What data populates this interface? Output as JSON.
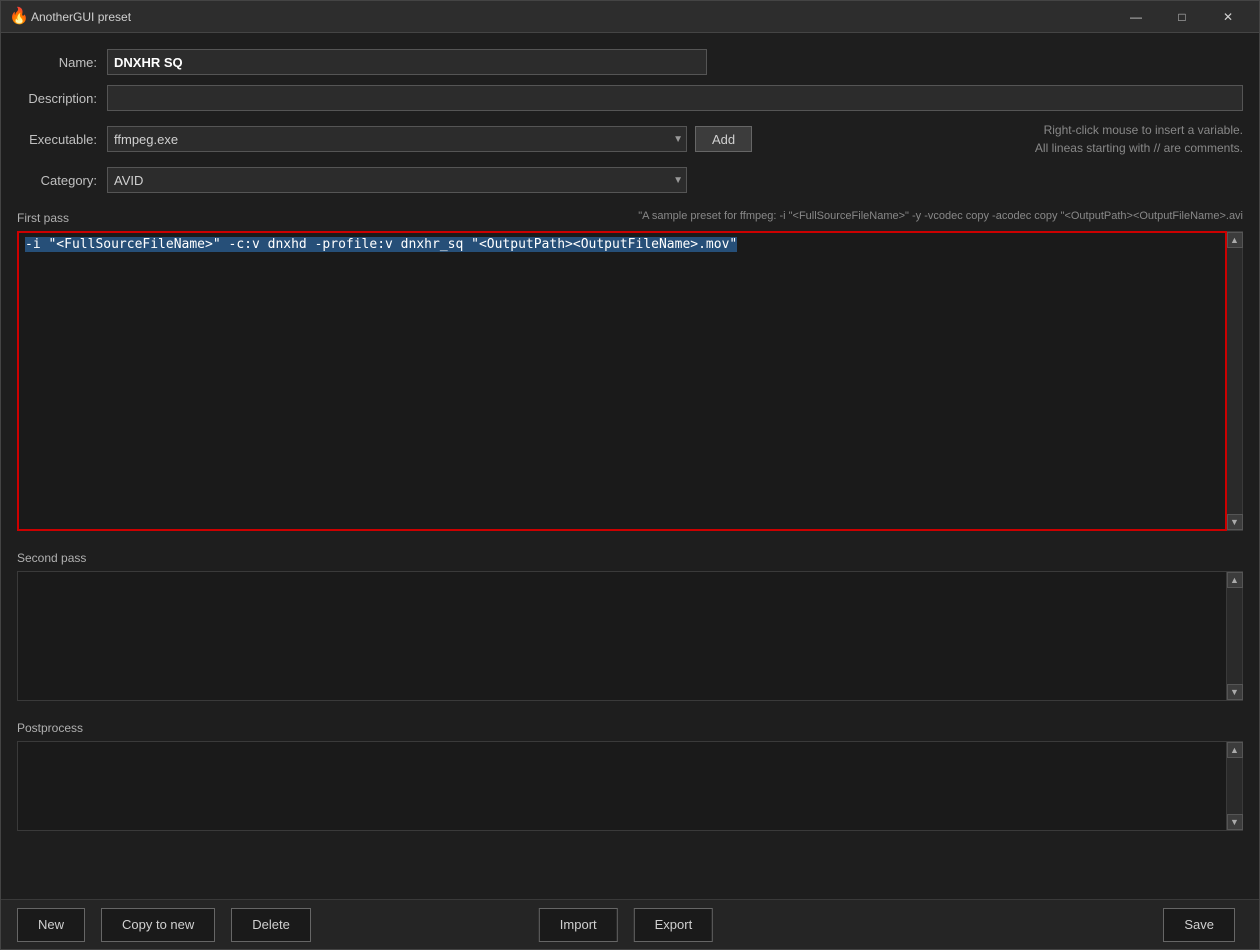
{
  "titlebar": {
    "icon": "🔥",
    "title": "AnotherGUI preset",
    "min_btn": "—",
    "max_btn": "□",
    "close_btn": "✕"
  },
  "form": {
    "name_label": "Name:",
    "name_value": "DNXHR SQ",
    "desc_label": "Description:",
    "desc_value": "",
    "executable_label": "Executable:",
    "executable_value": "ffmpeg.exe",
    "add_btn": "Add",
    "category_label": "Category:",
    "category_value": "AVID",
    "hint_line1": "Right-click mouse to insert a variable.",
    "hint_line2": "All lineas starting with // are comments."
  },
  "passes": {
    "first_pass_label": "First pass",
    "first_pass_hint": "\"A sample preset for ffmpeg:  -i \"<FullSourceFileName>\" -y  -vcodec copy -acodec copy \"<OutputPath><OutputFileName>.avi",
    "first_pass_content": "-i \"<FullSourceFileName>\" -c:v dnxhd -profile:v dnxhr_sq \"<OutputPath><OutputFileName>.mov\"",
    "second_pass_label": "Second pass",
    "second_pass_content": "",
    "postprocess_label": "Postprocess",
    "postprocess_content": ""
  },
  "buttons": {
    "new_label": "New",
    "copy_label": "Copy to new",
    "delete_label": "Delete",
    "import_label": "Import",
    "export_label": "Export",
    "save_label": "Save"
  }
}
